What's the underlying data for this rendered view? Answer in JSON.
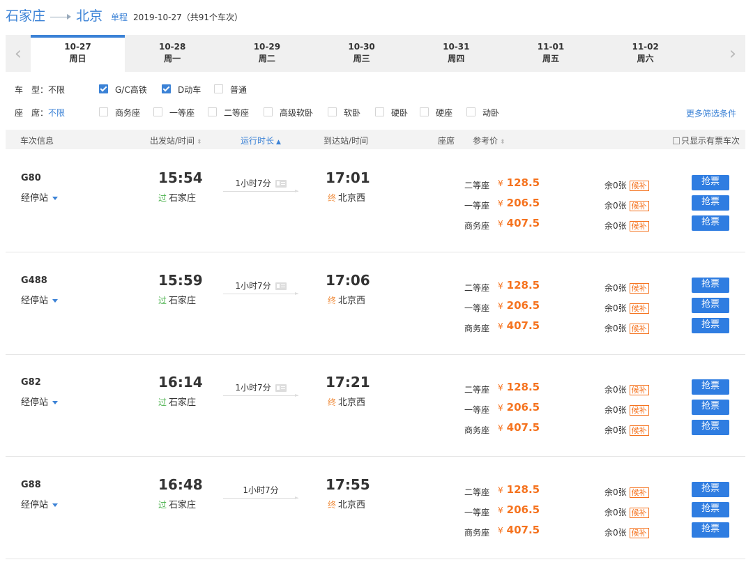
{
  "header": {
    "from": "石家庄",
    "to": "北京",
    "trip_type": "单程",
    "date_info": "2019-10-27（共91个车次）"
  },
  "date_tabs": [
    {
      "date": "10-27",
      "weekday": "周日",
      "active": true
    },
    {
      "date": "10-28",
      "weekday": "周一"
    },
    {
      "date": "10-29",
      "weekday": "周二"
    },
    {
      "date": "10-30",
      "weekday": "周三"
    },
    {
      "date": "10-31",
      "weekday": "周四"
    },
    {
      "date": "11-01",
      "weekday": "周五"
    },
    {
      "date": "11-02",
      "weekday": "周六"
    }
  ],
  "filters": {
    "type_label": "车　型：",
    "type_value": "不限",
    "type_options": [
      {
        "label": "G/C高铁",
        "checked": true
      },
      {
        "label": "D动车",
        "checked": true
      },
      {
        "label": "普通",
        "checked": false
      }
    ],
    "seat_label": "座　席：",
    "seat_value": "不限",
    "seat_options": [
      "商务座",
      "一等座",
      "二等座",
      "高级软卧",
      "软卧",
      "硬卧",
      "硬座",
      "动卧"
    ],
    "more": "更多筛选条件"
  },
  "columns": {
    "train_info": "车次信息",
    "depart": "出发站/时间",
    "duration": "运行时长",
    "arrive": "到达站/时间",
    "seat": "座席",
    "price": "参考价",
    "only_available": "只显示有票车次"
  },
  "trains": [
    {
      "no": "G80",
      "stops": "经停站",
      "dep_time": "15:54",
      "dep_tag": "过",
      "dep_station": "石家庄",
      "duration": "1小时7分",
      "id_icon": true,
      "arr_time": "17:01",
      "arr_tag": "终",
      "arr_station": "北京西",
      "seats": [
        {
          "name": "二等座",
          "price": "128.5",
          "remain": "余0张",
          "wait": "候补",
          "buy": "抢票"
        },
        {
          "name": "一等座",
          "price": "206.5",
          "remain": "余0张",
          "wait": "候补",
          "buy": "抢票"
        },
        {
          "name": "商务座",
          "price": "407.5",
          "remain": "余0张",
          "wait": "候补",
          "buy": "抢票"
        }
      ]
    },
    {
      "no": "G488",
      "stops": "经停站",
      "dep_time": "15:59",
      "dep_tag": "过",
      "dep_station": "石家庄",
      "duration": "1小时7分",
      "id_icon": true,
      "arr_time": "17:06",
      "arr_tag": "终",
      "arr_station": "北京西",
      "seats": [
        {
          "name": "二等座",
          "price": "128.5",
          "remain": "余0张",
          "wait": "候补",
          "buy": "抢票"
        },
        {
          "name": "一等座",
          "price": "206.5",
          "remain": "余0张",
          "wait": "候补",
          "buy": "抢票"
        },
        {
          "name": "商务座",
          "price": "407.5",
          "remain": "余0张",
          "wait": "候补",
          "buy": "抢票"
        }
      ]
    },
    {
      "no": "G82",
      "stops": "经停站",
      "dep_time": "16:14",
      "dep_tag": "过",
      "dep_station": "石家庄",
      "duration": "1小时7分",
      "id_icon": true,
      "arr_time": "17:21",
      "arr_tag": "终",
      "arr_station": "北京西",
      "seats": [
        {
          "name": "二等座",
          "price": "128.5",
          "remain": "余0张",
          "wait": "候补",
          "buy": "抢票"
        },
        {
          "name": "一等座",
          "price": "206.5",
          "remain": "余0张",
          "wait": "候补",
          "buy": "抢票"
        },
        {
          "name": "商务座",
          "price": "407.5",
          "remain": "余0张",
          "wait": "候补",
          "buy": "抢票"
        }
      ]
    },
    {
      "no": "G88",
      "stops": "经停站",
      "dep_time": "16:48",
      "dep_tag": "过",
      "dep_station": "石家庄",
      "duration": "1小时7分",
      "id_icon": false,
      "arr_time": "17:55",
      "arr_tag": "终",
      "arr_station": "北京西",
      "seats": [
        {
          "name": "二等座",
          "price": "128.5",
          "remain": "余0张",
          "wait": "候补",
          "buy": "抢票"
        },
        {
          "name": "一等座",
          "price": "206.5",
          "remain": "余0张",
          "wait": "候补",
          "buy": "抢票"
        },
        {
          "name": "商务座",
          "price": "407.5",
          "remain": "余0张",
          "wait": "候补",
          "buy": "抢票"
        }
      ]
    }
  ],
  "symbols": {
    "yen": "¥",
    "prev": "‹",
    "next": "›",
    "sort_up": "▲",
    "sort_both": "⬍"
  },
  "colors": {
    "accent": "#3b82d6",
    "price": "#f5731f",
    "button": "#2f7de1",
    "pass": "#48b04a"
  }
}
